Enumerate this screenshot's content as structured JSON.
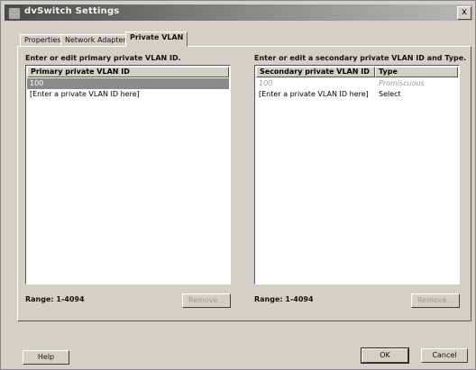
{
  "window": {
    "title": "dvSwitch Settings",
    "close_glyph": "x"
  },
  "tabs": [
    {
      "label": "Properties"
    },
    {
      "label": "Network Adapters"
    },
    {
      "label": "Private VLAN"
    }
  ],
  "primary": {
    "instruction": "Enter or edit primary private VLAN ID.",
    "column_header": "Primary private VLAN ID",
    "rows": [
      "100",
      "[Enter a private VLAN ID here]"
    ],
    "range_label": "Range: 1-4094",
    "remove_label": "Remove..."
  },
  "secondary": {
    "instruction": "Enter or edit a secondary private VLAN ID and Type.",
    "column_headers": [
      "Secondary private VLAN ID",
      "Type"
    ],
    "rows": [
      {
        "id": "100",
        "type": "Promiscuous"
      },
      {
        "id": "[Enter a private VLAN ID here]",
        "type": "Select"
      }
    ],
    "range_label": "Range: 1-4094",
    "remove_label": "Remove..."
  },
  "footer": {
    "help_label": "Help",
    "ok_label": "OK",
    "cancel_label": "Cancel"
  }
}
